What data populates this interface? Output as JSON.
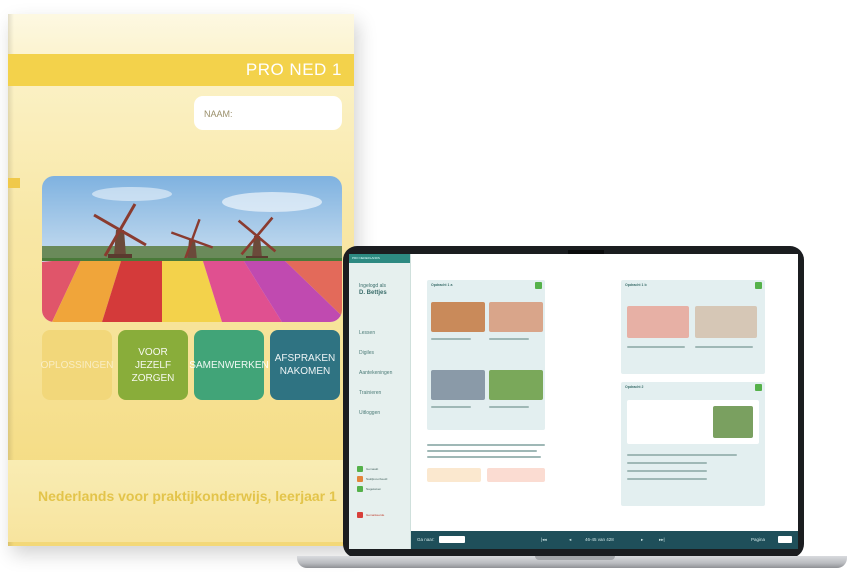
{
  "book": {
    "title": "PRO NED 1",
    "name_label": "NAAM:",
    "tiles": [
      {
        "label": "OPLOSSINGEN",
        "color": "#f2d77a"
      },
      {
        "label": "VOOR JEZELF ZORGEN",
        "color": "#89ad3a"
      },
      {
        "label": "SAMENWERKEN",
        "color": "#41a478"
      },
      {
        "label": "AFSPRAKEN NAKOMEN",
        "color": "#2f7382"
      }
    ],
    "subtitle": "Nederlands voor praktijkonderwijs, leerjaar 1",
    "accent_color": "#f3d24b"
  },
  "laptop": {
    "brand": "PRO NEDERLANDS",
    "author_prefix": "Ingelogd als",
    "author_name": "D. Bettjes",
    "nav_items": [
      "Lessen",
      "Digiles",
      "Aantekeningen",
      "Trainieren",
      "Uitloggen"
    ],
    "legend": [
      {
        "label": "Gemaakt",
        "color": "#55b14a"
      },
      {
        "label": "Nakijkvoorbeeld",
        "color": "#e3853b"
      },
      {
        "label": "Nagekeken",
        "color": "#55b14a"
      }
    ],
    "warning_label": "Gemarkeerde",
    "exercise_titles": [
      "Opdracht 1 a",
      "Opdracht 1 b",
      "Opdracht 2",
      "Opdracht 3"
    ],
    "page_bar": {
      "goto_label": "Ga naar:",
      "page_indicator": "46-45 van 428",
      "zoom_label": "Pagina"
    }
  }
}
